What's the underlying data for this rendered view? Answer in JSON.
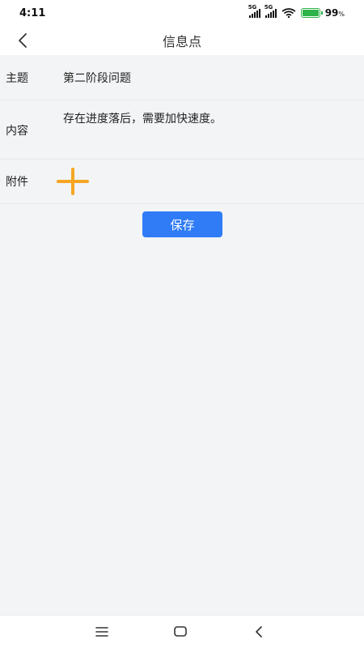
{
  "status_bar": {
    "time": "4:11",
    "network1": "5G",
    "network2": "5G",
    "battery_percent": "99",
    "battery_unit": "%",
    "battery_color": "#2db34a"
  },
  "header": {
    "title": "信息点",
    "back_icon": "chevron-left-icon"
  },
  "form": {
    "subject_label": "主题",
    "subject_value": "第二阶段问题",
    "content_label": "内容",
    "content_value": "存在进度落后，需要加快速度。",
    "attachment_label": "附件",
    "add_icon": "plus-icon",
    "add_color": "#f5a623"
  },
  "actions": {
    "save_label": "保存",
    "save_color": "#2f7cf6"
  },
  "system_nav": {
    "menu_icon": "menu-icon",
    "home_icon": "home-icon",
    "back_icon": "back-icon"
  }
}
